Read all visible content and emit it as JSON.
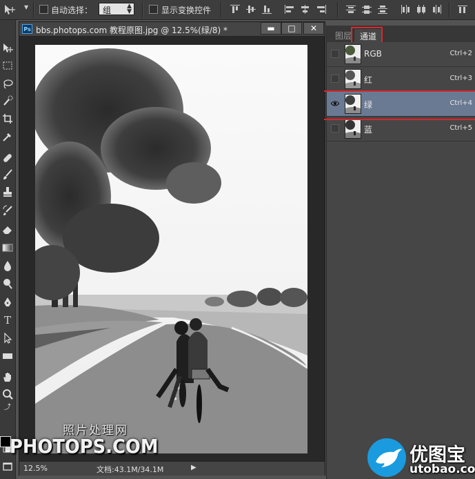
{
  "options_bar": {
    "auto_select_label": "自动选择：",
    "auto_select_value": "组",
    "show_transform_label": "显示变换控件"
  },
  "document": {
    "title": "bbs.photops.com 教程原图.jpg @ 12.5%(绿/8) *",
    "ps_badge": "Ps",
    "minimize": "▬",
    "maximize": "□",
    "close": "✕",
    "zoom": "12.5%",
    "doc_info": "文档:43.1M/34.1M"
  },
  "panel": {
    "tabs": [
      {
        "label": "图层",
        "active": false
      },
      {
        "label": "通道",
        "active": true
      }
    ],
    "channels": [
      {
        "name": "RGB",
        "shortcut": "Ctrl+2",
        "visible": false,
        "selected": false
      },
      {
        "name": "红",
        "shortcut": "Ctrl+3",
        "visible": false,
        "selected": false
      },
      {
        "name": "绿",
        "shortcut": "Ctrl+4",
        "visible": true,
        "selected": true
      },
      {
        "name": "蓝",
        "shortcut": "Ctrl+5",
        "visible": false,
        "selected": false
      }
    ]
  },
  "watermarks": {
    "cn": "照片处理网",
    "en": "PHOTOPS.COM",
    "site_cn": "优图宝",
    "site_url": "utobao.com"
  }
}
